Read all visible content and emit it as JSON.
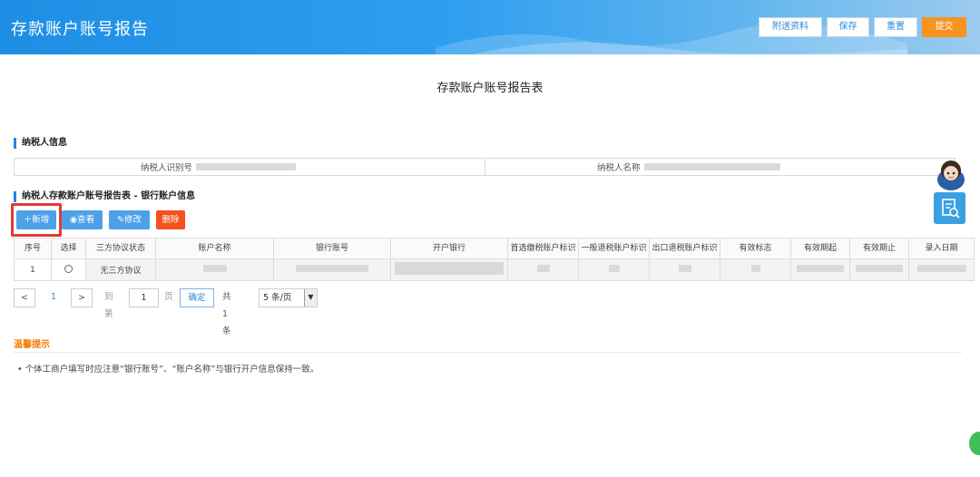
{
  "header": {
    "title": "存款账户账号报告",
    "buttons": {
      "attach": "附送资料",
      "save": "保存",
      "reset": "重置",
      "submit": "提交"
    }
  },
  "page_title": "存款账户账号报告表",
  "taxpayer_section": {
    "title": "纳税人信息",
    "id_label": "纳税人识别号",
    "name_label": "纳税人名称"
  },
  "account_section": {
    "title": "纳税人存款账户账号报告表 - 银行账户信息",
    "toolbar": {
      "add": "新增",
      "view": "查看",
      "edit": "修改",
      "delete": "删除"
    }
  },
  "table": {
    "headers": {
      "index": "序号",
      "select": "选择",
      "agreement": "三方协议状态",
      "account_name": "账户名称",
      "account_no": "银行账号",
      "bank": "开户银行",
      "first_tax": "首选缴税账户标识",
      "general_refund": "一般退税账户标识",
      "export_refund": "出口退税账户标识",
      "valid_flag": "有效标志",
      "valid_from": "有效期起",
      "valid_to": "有效期止",
      "entry_date": "录入日期"
    },
    "rows": [
      {
        "index": "1",
        "agreement": "无三方协议"
      }
    ]
  },
  "pager": {
    "prev": "<",
    "current": "1",
    "next": ">",
    "goto_prefix": "到第",
    "goto_value": "1",
    "goto_suffix": "页",
    "confirm": "确定",
    "total": "共 1 条",
    "page_size": "5 条/页"
  },
  "tips": {
    "title": "温馨提示",
    "text": "• 个体工商户填写时应注意“银行账号”、“账户名称”与银行开户信息保持一致。"
  },
  "colors": {
    "header_blue": "#1e8ee4",
    "accent_orange": "#f7931e",
    "delete_red": "#f4511e",
    "highlight_red": "#e53935"
  }
}
